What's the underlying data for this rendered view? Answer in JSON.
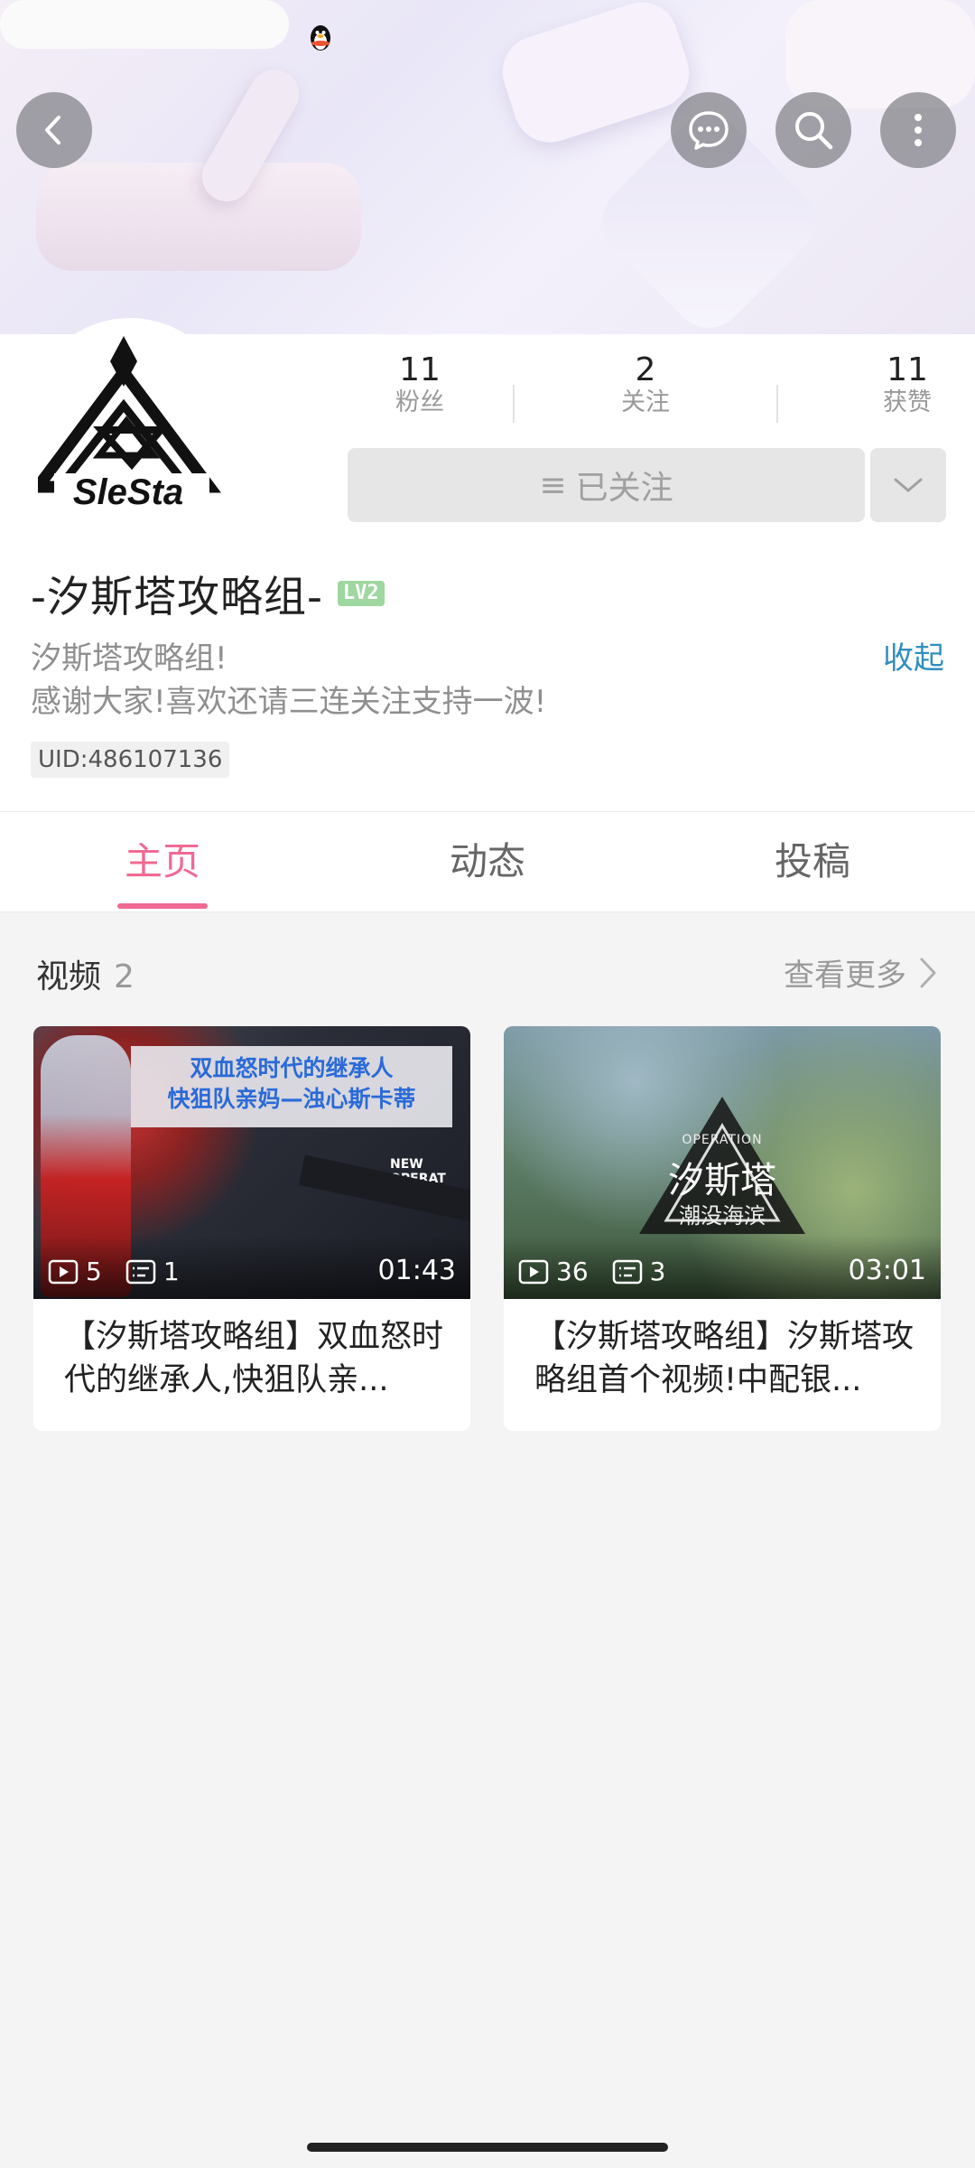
{
  "header": {
    "back_icon": "chevron-left-icon",
    "actions": [
      "message-icon",
      "search-icon",
      "more-vertical-icon"
    ]
  },
  "profile": {
    "stats": [
      {
        "value": "11",
        "label": "粉丝"
      },
      {
        "value": "2",
        "label": "关注"
      },
      {
        "value": "11",
        "label": "获赞"
      }
    ],
    "follow_label": "已关注",
    "name": "-汐斯塔攻略组-",
    "level": "LV2",
    "bio_line1": "汐斯塔攻略组!",
    "bio_line2": "感谢大家!喜欢还请三连关注支持一波!",
    "collapse_label": "收起",
    "uid": "UID:486107136",
    "avatar_text": "SleSta"
  },
  "tabs": [
    {
      "label": "主页",
      "active": true
    },
    {
      "label": "动态",
      "active": false
    },
    {
      "label": "投稿",
      "active": false
    }
  ],
  "videos_section": {
    "title": "视频",
    "count": "2",
    "see_more": "查看更多"
  },
  "videos": [
    {
      "plays": "5",
      "comments": "1",
      "duration": "01:43",
      "title": "【汐斯塔攻略组】双血怒时代的继承人,快狙队亲...",
      "thumb_text_line1": "双血怒时代的继承人",
      "thumb_text_line2": "快狙队亲妈—浊心斯卡蒂",
      "thumb_tag": "NEW OPERAT"
    },
    {
      "plays": "36",
      "comments": "3",
      "duration": "03:01",
      "title": "【汐斯塔攻略组】汐斯塔攻略组首个视频!中配银...",
      "thumb_op": "OPERATION",
      "thumb_title": "汐斯塔",
      "thumb_sub": "潮没海滨"
    }
  ],
  "colors": {
    "accent_pink": "#f06a93",
    "link_blue": "#2f8fbf",
    "level_green": "#9ed7a0"
  }
}
